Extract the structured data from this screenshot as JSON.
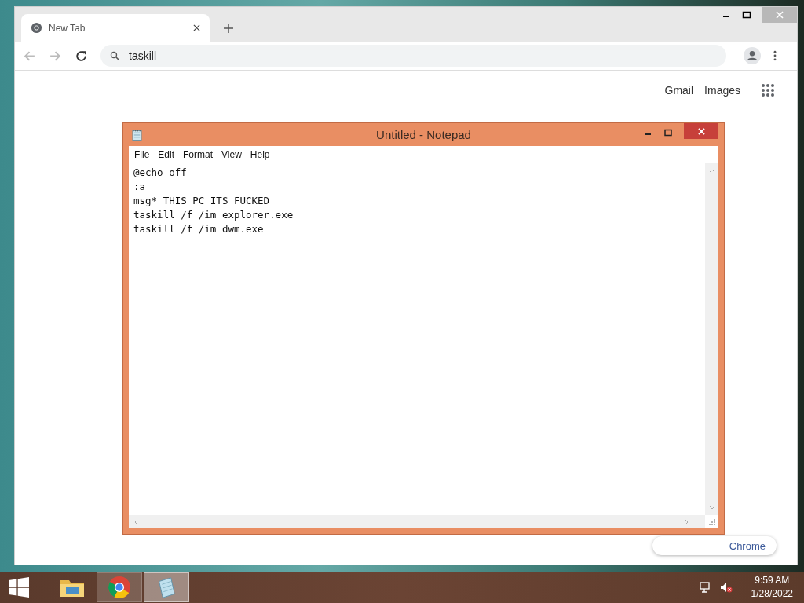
{
  "chrome": {
    "tab": {
      "title": "New Tab",
      "selected": true
    },
    "address": {
      "value": "taskill"
    },
    "links": [
      "Gmail",
      "Images"
    ],
    "customize_button": "Chrome"
  },
  "notepad": {
    "title": "Untitled - Notepad",
    "menu": [
      "File",
      "Edit",
      "Format",
      "View",
      "Help"
    ],
    "lines": [
      "@echo off",
      ":a",
      "msg* THIS PC ITS FUCKED",
      "taskill /f /im explorer.exe",
      "taskill /f /im dwm.exe"
    ]
  },
  "taskbar": {
    "apps": [
      {
        "kind": "explorer",
        "running": false,
        "selected": false
      },
      {
        "kind": "chrome",
        "running": true,
        "selected": false
      },
      {
        "kind": "notepad",
        "running": true,
        "selected": true
      }
    ],
    "time": "9:59 AM",
    "date": "1/28/2022"
  }
}
